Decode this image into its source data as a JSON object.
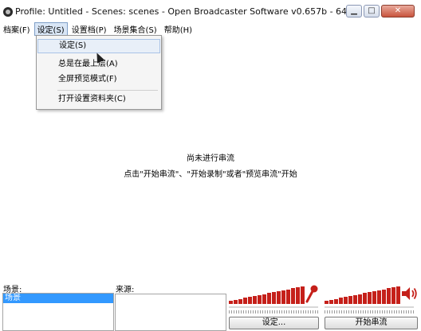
{
  "window": {
    "title": "Profile: Untitled - Scenes: scenes - Open Broadcaster Software v0.657b - 64bit"
  },
  "menu": {
    "items": [
      {
        "label": "档案(F)"
      },
      {
        "label": "设定(S)"
      },
      {
        "label": "设置档(P)"
      },
      {
        "label": "场景集合(S)"
      },
      {
        "label": "帮助(H)"
      }
    ],
    "active_index": 1
  },
  "dropdown": {
    "items": [
      {
        "label": "设定(S)"
      },
      {
        "label": "总是在最上层(A)"
      },
      {
        "label": "全屏预览模式(F)"
      },
      {
        "label": "打开设置资料夹(C)"
      }
    ]
  },
  "main": {
    "status_line1": "尚未进行串流",
    "status_line2": "点击\"开始串流\"、\"开始录制\"或者\"预览串流\"开始"
  },
  "scenes": {
    "label": "场景:",
    "items": [
      {
        "label": "场景"
      }
    ]
  },
  "sources": {
    "label": "来源:"
  },
  "audio": {
    "mic_level": 1.0,
    "desktop_level": 1.0,
    "meter_color": "#c5201a"
  },
  "buttons": {
    "settings": "设定...",
    "start_stream": "开始串流"
  },
  "icons": {
    "mic": "microphone-icon",
    "speaker": "speaker-icon"
  }
}
